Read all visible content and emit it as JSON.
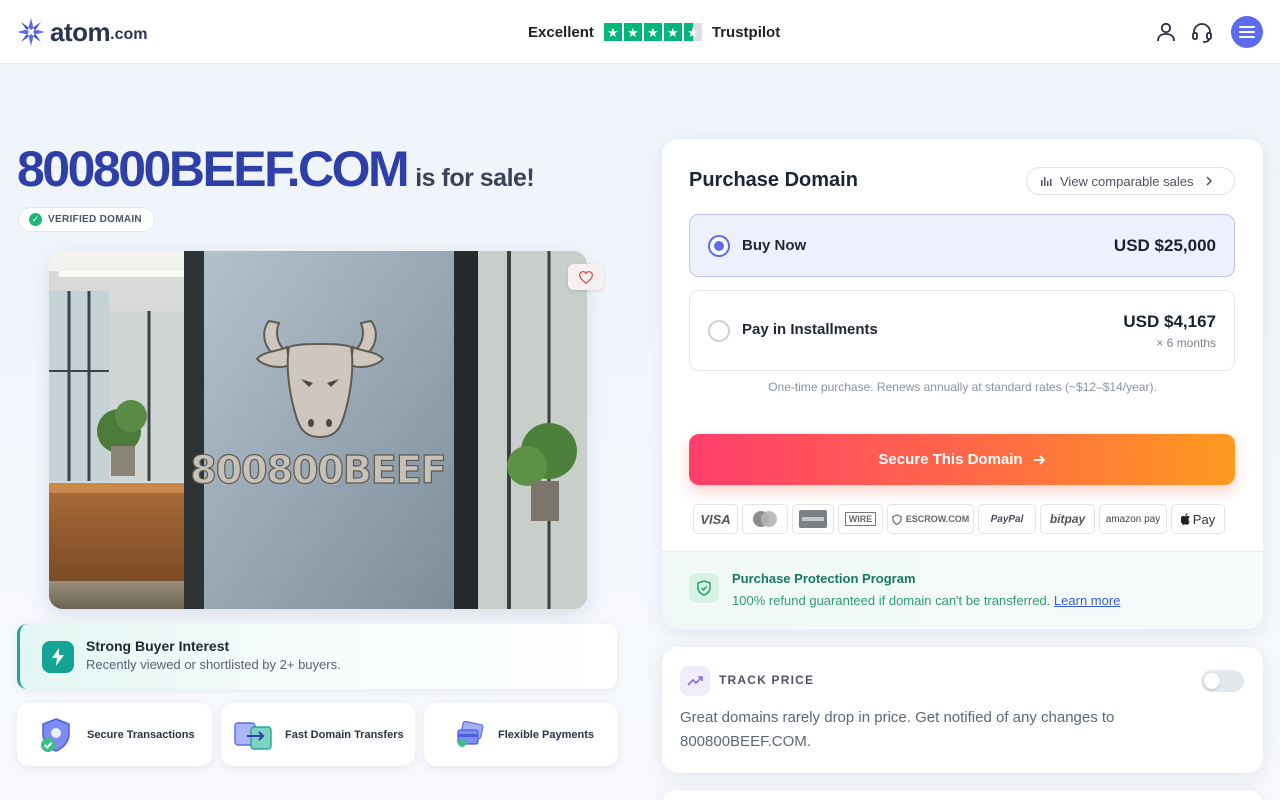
{
  "header": {
    "logo_word": "atom",
    "logo_tld": ".com",
    "trustpilot": {
      "rating_text": "Excellent",
      "brand": "Trustpilot",
      "stars": 4.5
    },
    "icons": [
      "user-icon",
      "headset-icon",
      "menu-icon"
    ]
  },
  "listing": {
    "domain": "800800BEEF.COM",
    "for_sale": "is for sale!",
    "verified": "VERIFIED DOMAIN",
    "image_text": "800800BEEF"
  },
  "interest": {
    "title": "Strong Buyer Interest",
    "subtitle": "Recently viewed or shortlisted by 2+ buyers."
  },
  "features": [
    {
      "label": "Secure Transactions"
    },
    {
      "label": "Fast Domain Transfers"
    },
    {
      "label": "Flexible Payments"
    }
  ],
  "purchase": {
    "title": "Purchase Domain",
    "comparable": "View comparable sales",
    "options": [
      {
        "label": "Buy Now",
        "price": "USD $25,000",
        "selected": true
      },
      {
        "label": "Pay in Installments",
        "price": "USD $4,167",
        "sub": "× 6 months",
        "selected": false
      }
    ],
    "renew_note": "One-time purchase. Renews annually at standard rates (~$12–$14/year).",
    "cta": "Secure This Domain",
    "payment_methods": [
      "VISA",
      "MasterCard",
      "AMEX",
      "WIRE",
      "ESCROW.COM",
      "PayPal",
      "bitpay",
      "amazon pay",
      "Pay"
    ],
    "protection": {
      "title": "Purchase Protection Program",
      "text": "100% refund guaranteed if domain can't be transferred.",
      "link": "Learn more"
    }
  },
  "track": {
    "title": "TRACK PRICE",
    "text": "Great domains rarely drop in price. Get notified of any changes to 800800BEEF.COM.",
    "enabled": false
  },
  "colors": {
    "brand": "#2f3fa8",
    "accent": "#5b6cf0",
    "cta_start": "#ff3e6c",
    "cta_end": "#ff9a1f",
    "success": "#22b573",
    "trustpilot": "#00b67a"
  }
}
